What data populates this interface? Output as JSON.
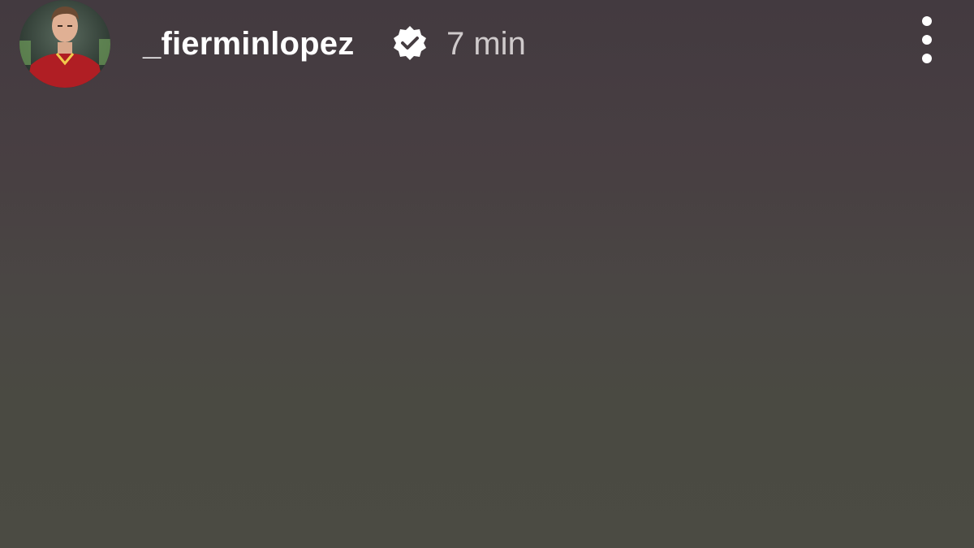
{
  "story": {
    "username": "_fierminlopez",
    "verified": true,
    "time_ago": "7 min",
    "more_options_icon": "more-vertical-icon",
    "verified_icon": "verified-badge-icon"
  },
  "colors": {
    "username": "#ffffff",
    "time_ago": "#cfcacb",
    "background_top": "#433a40",
    "background_bottom": "#4b4b43",
    "jersey": "#b01e24"
  }
}
